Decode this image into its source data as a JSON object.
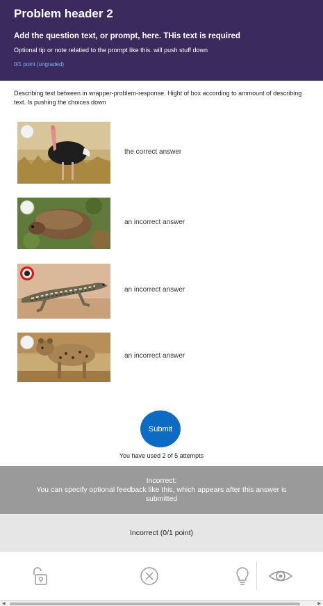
{
  "header": {
    "title": "Problem header 2",
    "prompt": "Add the question text, or prompt, here. THis text is required",
    "tip": "Optional tip or note relatied to the prompt like this. will push stuff down",
    "points": "0/1 point (ungraded)"
  },
  "description": "Describing text between in wrapper-problem-response. Hight of box according to ammount of describing text. Is pushing the choices down",
  "choices": [
    {
      "label": "the correct answer",
      "image_icon": "ostrich-image",
      "selected": false
    },
    {
      "label": "an incorrect answer",
      "image_icon": "beaver-image",
      "selected": false
    },
    {
      "label": "an incorrect answer",
      "image_icon": "lizard-image",
      "selected": true
    },
    {
      "label": "an incorrect answer",
      "image_icon": "hyena-image",
      "selected": false
    }
  ],
  "submit": {
    "label": "Submit"
  },
  "attempts": "You have used 2 of 5 attempts",
  "feedback": {
    "title": "Incorrect:",
    "text": "You can specify optional feedback like this, which appears after this answer is submitted"
  },
  "result": "Incorrect (0/1 point)",
  "toolbar": {
    "icons": [
      "unlock-icon",
      "close-circle-icon",
      "lightbulb-icon",
      "eye-icon"
    ]
  },
  "colors": {
    "header_bg": "#3b2a5e",
    "points_text": "#7fb3ff",
    "submit_bg": "#0d6bc4",
    "selected_radio": "#e01414",
    "feedback_bg": "#9a9a9a",
    "result_bg": "#e6e6e6"
  }
}
